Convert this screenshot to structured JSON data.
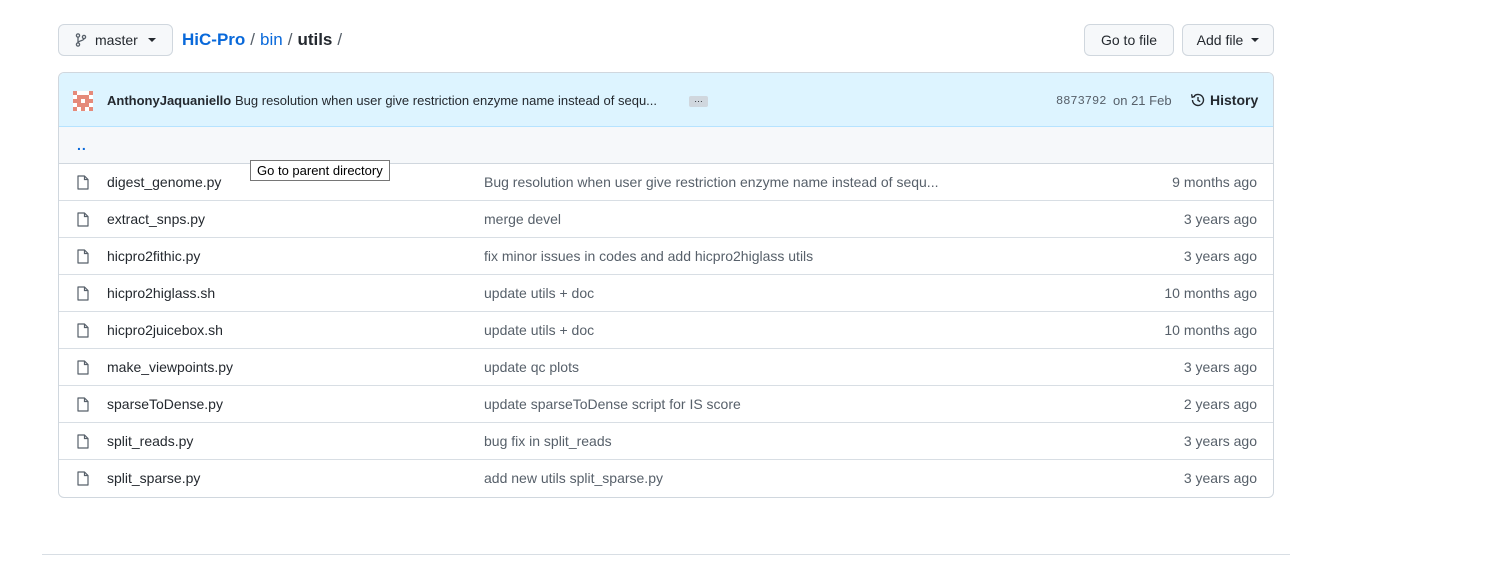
{
  "branch": {
    "label": "master",
    "icon": "git-branch-icon"
  },
  "breadcrumb": {
    "repo": "HiC-Pro",
    "sep1": "/",
    "dir": "bin",
    "sep2": "/",
    "current": "utils",
    "sep3": "/"
  },
  "actions": {
    "go_to_file": "Go to file",
    "add_file": "Add file"
  },
  "commit": {
    "author": "AnthonyJaquaniello",
    "message": "Bug resolution when user give restriction enzyme name instead of sequ...",
    "ellipsis": "…",
    "sha": "8873792",
    "date": "on 21 Feb",
    "history_label": "History"
  },
  "parent": {
    "label": "..",
    "tooltip": "Go to parent directory"
  },
  "files": [
    {
      "name": "digest_genome.py",
      "message": "Bug resolution when user give restriction enzyme name instead of sequ...",
      "age": "9 months ago"
    },
    {
      "name": "extract_snps.py",
      "message": "merge devel",
      "age": "3 years ago"
    },
    {
      "name": "hicpro2fithic.py",
      "message": "fix minor issues in codes and add hicpro2higlass utils",
      "age": "3 years ago"
    },
    {
      "name": "hicpro2higlass.sh",
      "message": "update utils + doc",
      "age": "10 months ago"
    },
    {
      "name": "hicpro2juicebox.sh",
      "message": "update utils + doc",
      "age": "10 months ago"
    },
    {
      "name": "make_viewpoints.py",
      "message": "update qc plots",
      "age": "3 years ago"
    },
    {
      "name": "sparseToDense.py",
      "message": "update sparseToDense script for IS score",
      "age": "2 years ago"
    },
    {
      "name": "split_reads.py",
      "message": "bug fix in split_reads",
      "age": "3 years ago"
    },
    {
      "name": "split_sparse.py",
      "message": "add new utils split_sparse.py",
      "age": "3 years ago"
    }
  ],
  "colors": {
    "link": "#0969da",
    "commit_bg": "#ddf4ff",
    "muted": "#57606a"
  }
}
